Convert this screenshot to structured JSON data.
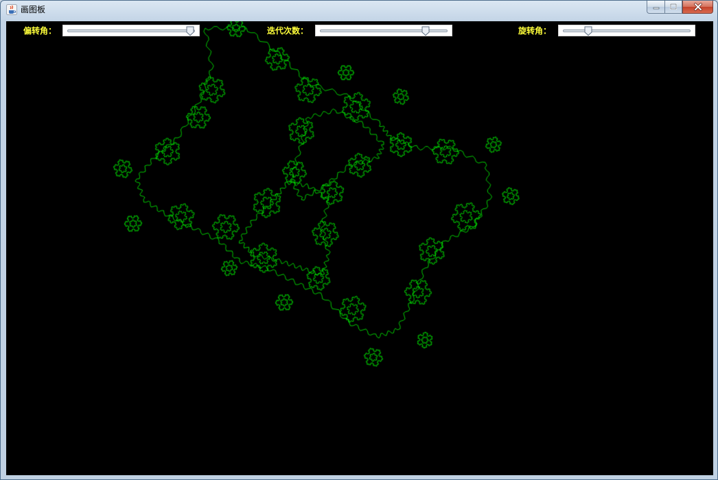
{
  "window": {
    "title": "画图板",
    "icon": "java-cup-icon",
    "frame_color": "#c3d4e6",
    "close_color": "#c4422b"
  },
  "canvas": {
    "background": "#000000",
    "curve_color": "#00ff00"
  },
  "controls": {
    "label_color": "#ffff3a",
    "sliders": [
      {
        "label": "偏转角：",
        "value_fraction": 0.96
      },
      {
        "label": "迭代次数：",
        "value_fraction": 0.83
      },
      {
        "label": "旋转角：",
        "value_fraction": 0.2
      }
    ]
  }
}
